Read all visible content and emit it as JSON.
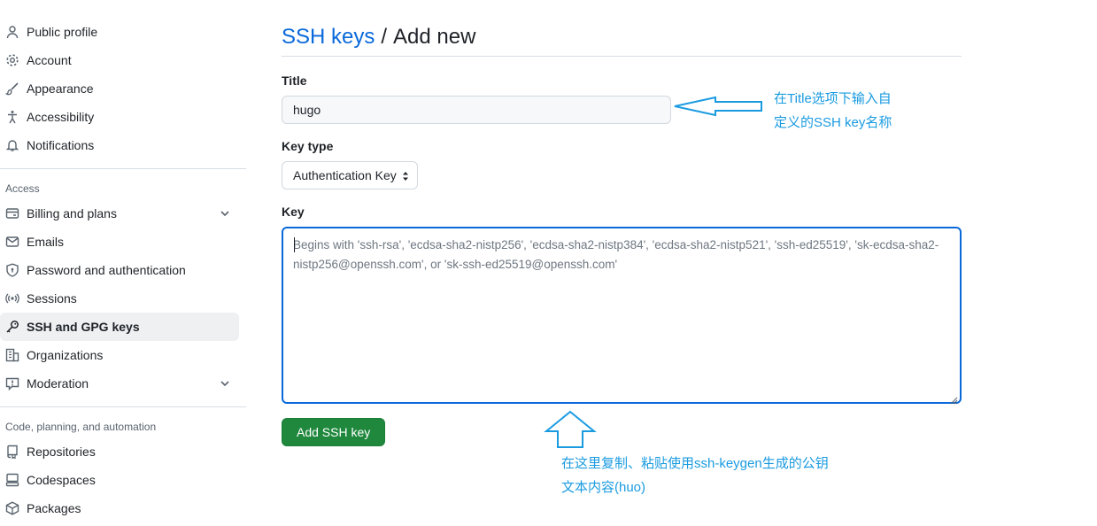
{
  "sidebar": {
    "items_top": [
      {
        "label": "Public profile",
        "icon": "person-icon"
      },
      {
        "label": "Account",
        "icon": "gear-icon"
      },
      {
        "label": "Appearance",
        "icon": "paintbrush-icon"
      },
      {
        "label": "Accessibility",
        "icon": "accessibility-icon"
      },
      {
        "label": "Notifications",
        "icon": "bell-icon"
      }
    ],
    "access_heading": "Access",
    "items_access": [
      {
        "label": "Billing and plans",
        "icon": "credit-card-icon"
      },
      {
        "label": "Emails",
        "icon": "mail-icon"
      },
      {
        "label": "Password and authentication",
        "icon": "shield-lock-icon"
      },
      {
        "label": "Sessions",
        "icon": "broadcast-icon"
      },
      {
        "label": "SSH and GPG keys",
        "icon": "key-icon"
      },
      {
        "label": "Organizations",
        "icon": "organization-icon"
      },
      {
        "label": "Moderation",
        "icon": "report-icon"
      }
    ],
    "code_heading": "Code, planning, and automation",
    "items_code": [
      {
        "label": "Repositories",
        "icon": "repo-icon"
      },
      {
        "label": "Codespaces",
        "icon": "codespaces-icon"
      },
      {
        "label": "Packages",
        "icon": "package-icon"
      }
    ]
  },
  "header": {
    "crumb_link": "SSH keys",
    "separator": "/",
    "current": "Add new"
  },
  "form": {
    "title_label": "Title",
    "title_value": "hugo",
    "key_type_label": "Key type",
    "key_type_value": "Authentication Key",
    "key_label": "Key",
    "key_placeholder": "Begins with 'ssh-rsa', 'ecdsa-sha2-nistp256', 'ecdsa-sha2-nistp384', 'ecdsa-sha2-nistp521', 'ssh-ed25519', 'sk-ecdsa-sha2-nistp256@openssh.com', or 'sk-ssh-ed25519@openssh.com'",
    "submit_label": "Add SSH key"
  },
  "annotations": {
    "title_note_line1": "在Title选项下输入自",
    "title_note_line2": "定义的SSH key名称",
    "key_note_line1": "在这里复制、粘贴使用ssh-keygen生成的公钥",
    "key_note_line2": "文本内容(huo)",
    "color": "#1a9be0"
  },
  "colors": {
    "accent": "#0969da",
    "button": "#1f883d",
    "active_bg": "#eef0f2"
  }
}
